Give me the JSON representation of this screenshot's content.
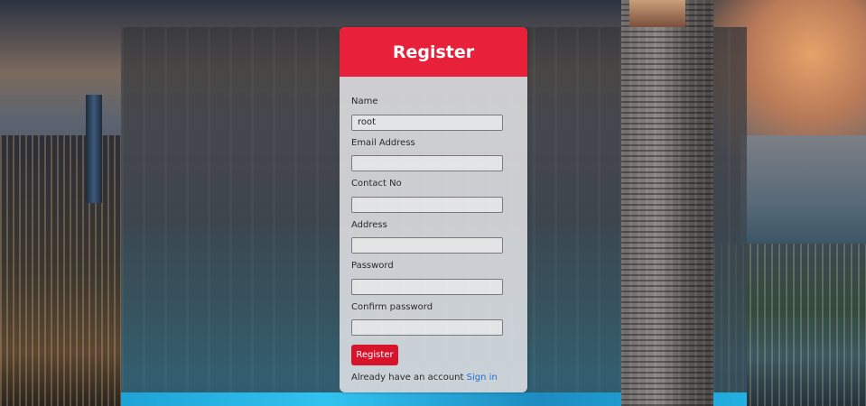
{
  "register_form": {
    "title": "Register",
    "fields": [
      {
        "label": "Name",
        "value": "root",
        "placeholder": ""
      },
      {
        "label": "Email Address",
        "value": "",
        "placeholder": ""
      },
      {
        "label": "Contact No",
        "value": "",
        "placeholder": ""
      },
      {
        "label": "Address",
        "value": "",
        "placeholder": ""
      },
      {
        "label": "Password",
        "value": "",
        "placeholder": ""
      },
      {
        "label": "Confirm password",
        "value": "",
        "placeholder": ""
      }
    ],
    "submit_label": "Register",
    "account_prompt": "Already have an account",
    "signin_link": "Sign in"
  },
  "colors": {
    "header_red": "#e8203a",
    "button_red": "#d8142c",
    "link_blue": "#1f6fd6"
  }
}
